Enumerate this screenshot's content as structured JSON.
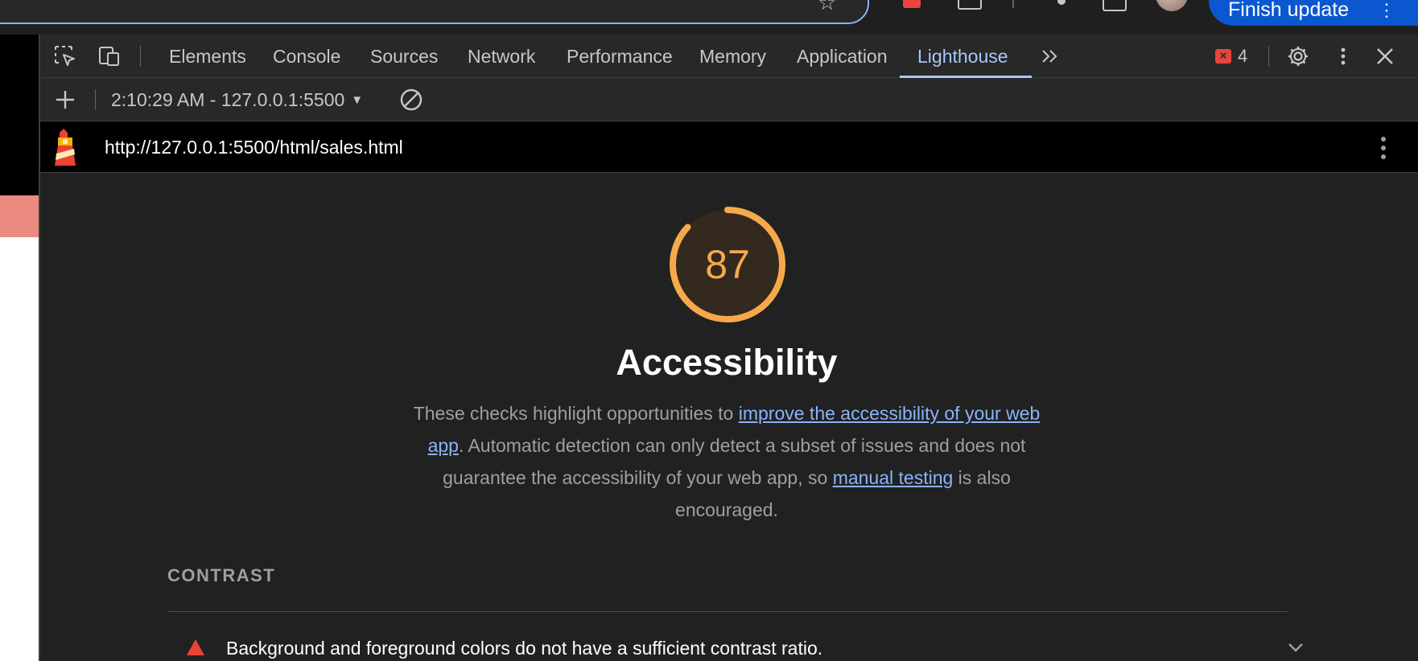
{
  "browser": {
    "update_button": "Finish update"
  },
  "devtools": {
    "tabs": [
      "Elements",
      "Console",
      "Sources",
      "Network",
      "Performance",
      "Memory",
      "Application",
      "Lighthouse"
    ],
    "active_tab": "Lighthouse",
    "issues_count": "4"
  },
  "lighthouse": {
    "report_selector": "2:10:29 AM - 127.0.0.1:5500",
    "url": "http://127.0.0.1:5500/html/sales.html",
    "score": 87,
    "score_color": "#f6a94c",
    "category_title": "Accessibility",
    "description": {
      "part1": "These checks highlight opportunities to ",
      "link1": "improve the accessibility of your web app",
      "part2": ". Automatic detection can only detect a subset of issues and does not guarantee the accessibility of your web app, so ",
      "link2": "manual testing",
      "part3": " is also encouraged."
    },
    "group_title": "CONTRAST",
    "audits": [
      {
        "status": "fail",
        "title": "Background and foreground colors do not have a sufficient contrast ratio."
      }
    ]
  },
  "colors": {
    "accent": "#a8c7fa",
    "fail": "#ea4335",
    "average": "#f6a94c"
  }
}
